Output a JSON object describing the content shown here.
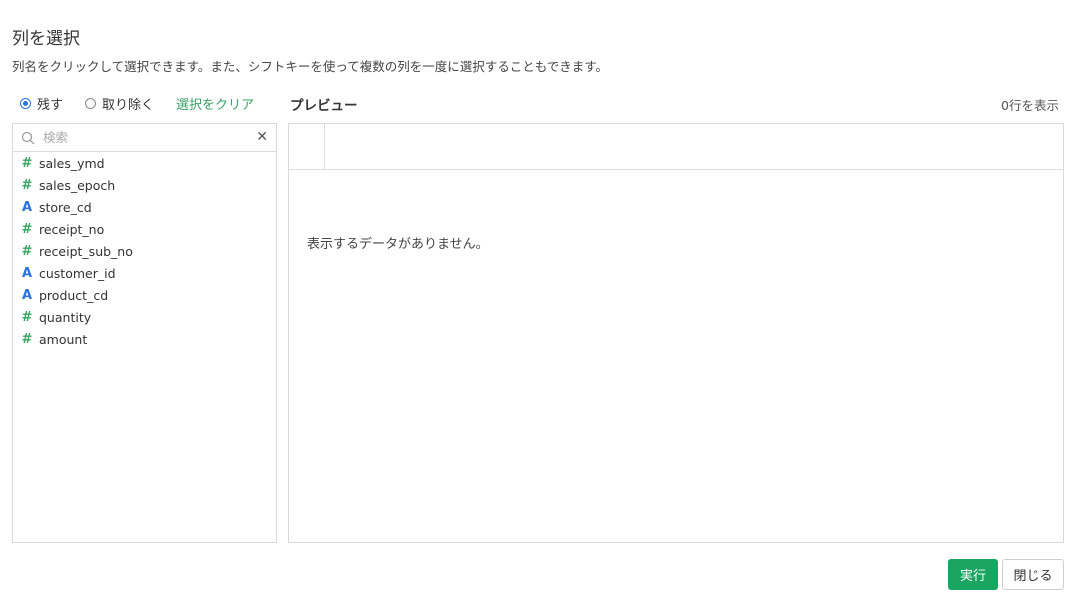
{
  "dialog": {
    "title": "列を選択",
    "description": "列名をクリックして選択できます。また、シフトキーを使って複数の列を一度に選択することもできます。"
  },
  "mode": {
    "keep_label": "残す",
    "remove_label": "取り除く",
    "selected": "keep",
    "clear_selection_label": "選択をクリア"
  },
  "column_list": {
    "search_placeholder": "検索",
    "columns": [
      {
        "name": "sales_ymd",
        "type_symbol": "#",
        "type": "numeric"
      },
      {
        "name": "sales_epoch",
        "type_symbol": "#",
        "type": "numeric"
      },
      {
        "name": "store_cd",
        "type_symbol": "A",
        "type": "string"
      },
      {
        "name": "receipt_no",
        "type_symbol": "#",
        "type": "numeric"
      },
      {
        "name": "receipt_sub_no",
        "type_symbol": "#",
        "type": "numeric"
      },
      {
        "name": "customer_id",
        "type_symbol": "A",
        "type": "string"
      },
      {
        "name": "product_cd",
        "type_symbol": "A",
        "type": "string"
      },
      {
        "name": "quantity",
        "type_symbol": "#",
        "type": "numeric"
      },
      {
        "name": "amount",
        "type_symbol": "#",
        "type": "numeric"
      }
    ]
  },
  "preview": {
    "title": "プレビュー",
    "row_count_label": "0行を表示",
    "empty_message": "表示するデータがありません。"
  },
  "footer": {
    "run_label": "実行",
    "close_label": "閉じる"
  },
  "colors": {
    "accent_green": "#1aa560",
    "numeric_icon": "#3aa364",
    "string_icon": "#2a73d9",
    "radio_selected": "#2a73d9"
  }
}
